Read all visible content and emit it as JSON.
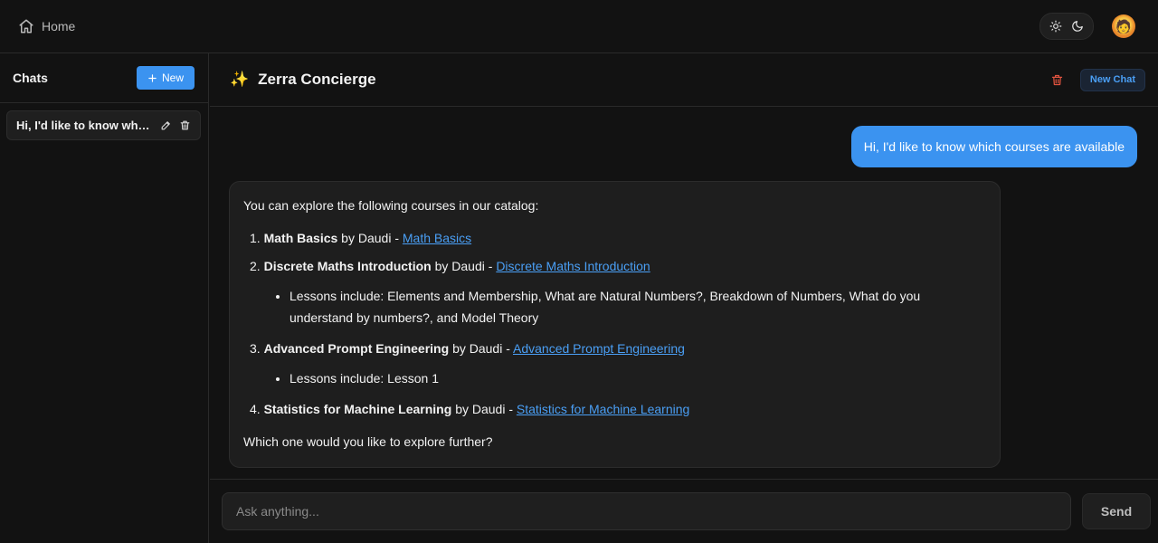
{
  "topbar": {
    "home_label": "Home",
    "home_icon": "home-icon",
    "theme_icons": [
      "sun-icon",
      "moon-icon"
    ],
    "avatar_icon": "avatar-emoji"
  },
  "sidebar": {
    "title": "Chats",
    "new_label": "New",
    "chats": [
      {
        "label": "Hi, I'd like to know which courses are available"
      }
    ]
  },
  "main": {
    "title": "Zerra Concierge",
    "title_icon": "sparkle-icon",
    "new_chat_label": "New Chat",
    "user_message": "Hi, I'd like to know which courses are available",
    "bot": {
      "intro": "You can explore the following courses in our catalog:",
      "courses": [
        {
          "num": "1.",
          "name": "Math Basics",
          "by": "by Daudi -",
          "link": "Math Basics",
          "lessons": ""
        },
        {
          "num": "2.",
          "name": "Discrete Maths Introduction",
          "by": "by Daudi -",
          "link": "Discrete Maths Introduction",
          "lessons": "Lessons include: Elements and Membership, What are Natural Numbers?, Breakdown of Numbers, What do you understand by numbers?, and Model Theory"
        },
        {
          "num": "3.",
          "name": "Advanced Prompt Engineering",
          "by": "by Daudi -",
          "link": "Advanced Prompt Engineering",
          "lessons": "Lessons include: Lesson 1"
        },
        {
          "num": "4.",
          "name": "Statistics for Machine Learning",
          "by": "by Daudi -",
          "link": "Statistics for Machine Learning",
          "lessons": ""
        }
      ],
      "outro": "Which one would you like to explore further?"
    }
  },
  "composer": {
    "placeholder": "Ask anything...",
    "send_label": "Send"
  },
  "colors": {
    "accent": "#3b93f0",
    "link": "#4a9ff5",
    "danger": "#e0533f",
    "background": "#121212"
  }
}
